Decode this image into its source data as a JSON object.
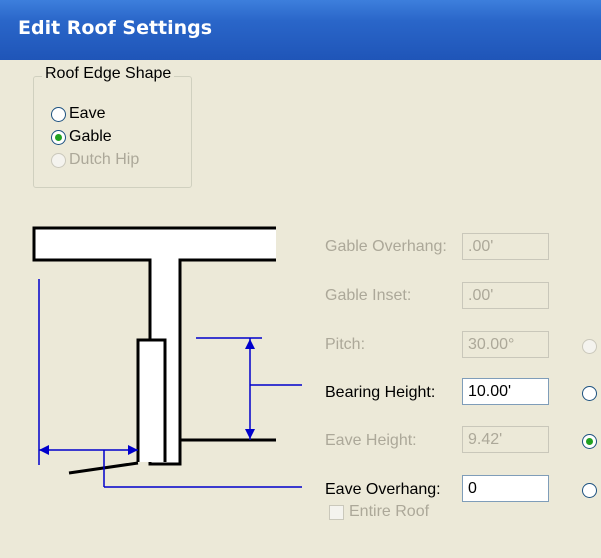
{
  "window": {
    "title": "Edit Roof Settings"
  },
  "roof_edge_shape": {
    "legend": "Roof Edge Shape",
    "options": [
      {
        "label": "Eave",
        "selected": false,
        "enabled": true
      },
      {
        "label": "Gable",
        "selected": true,
        "enabled": true
      },
      {
        "label": "Dutch Hip",
        "selected": false,
        "enabled": false
      }
    ]
  },
  "fields": {
    "gable_overhang": {
      "label": "Gable Overhang:",
      "value": ".00'",
      "enabled": false
    },
    "gable_inset": {
      "label": "Gable Inset:",
      "value": ".00'",
      "enabled": false
    },
    "pitch": {
      "label": "Pitch:",
      "value": "30.00°",
      "enabled": false
    },
    "bearing_height": {
      "label": "Bearing Height:",
      "value": "10.00'",
      "enabled": true
    },
    "eave_height": {
      "label": "Eave Height:",
      "value": "9.42'",
      "enabled": false
    },
    "eave_overhang": {
      "label": "Eave Overhang:",
      "value": "0",
      "enabled": true
    }
  },
  "lock_radios": [
    {
      "row": "pitch",
      "selected": false,
      "enabled": false
    },
    {
      "row": "bearing_height",
      "selected": false,
      "enabled": true
    },
    {
      "row": "eave_height",
      "selected": true,
      "enabled": true
    },
    {
      "row": "eave_overhang",
      "selected": false,
      "enabled": true
    }
  ],
  "entire_roof": {
    "label": "Entire Roof",
    "checked": false,
    "enabled": false
  },
  "colors": {
    "title_bar": "#2a66c9",
    "dialog_bg": "#ece9d8",
    "dimension_line": "#0000cc",
    "radio_selected": "#21a121",
    "disabled_text": "#aca899"
  },
  "icons": [
    "roof-section-diagram"
  ]
}
